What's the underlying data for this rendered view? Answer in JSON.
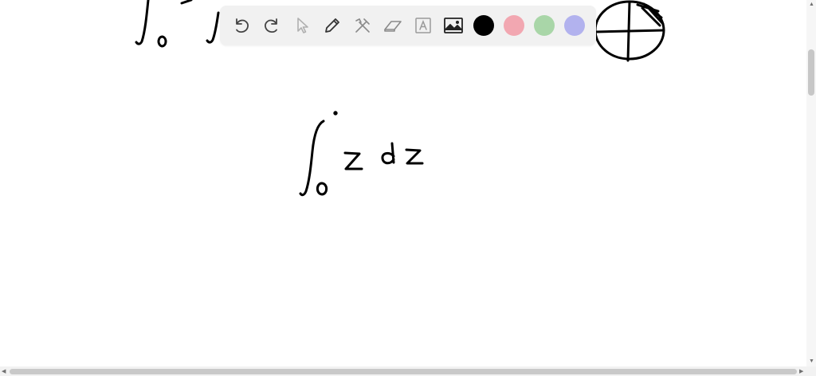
{
  "toolbar": {
    "tools": [
      {
        "name": "undo-icon",
        "label": "undo"
      },
      {
        "name": "redo-icon",
        "label": "redo"
      },
      {
        "name": "select-pointer-icon",
        "label": "select"
      },
      {
        "name": "pen-icon",
        "label": "pen"
      },
      {
        "name": "tools-icon",
        "label": "tools"
      },
      {
        "name": "eraser-icon",
        "label": "eraser"
      },
      {
        "name": "text-box-icon",
        "label": "text"
      },
      {
        "name": "image-icon",
        "label": "image"
      }
    ],
    "colors": [
      {
        "name": "color-black",
        "hex": "#000000",
        "selected": true
      },
      {
        "name": "color-pink",
        "hex": "#f2a7b1",
        "selected": false
      },
      {
        "name": "color-green",
        "hex": "#a9d6a8",
        "selected": false
      },
      {
        "name": "color-purple",
        "hex": "#b2b2ee",
        "selected": false
      }
    ]
  },
  "canvas": {
    "ink_color": "#000000",
    "handwriting": {
      "main_expression": "∫₀ z dz",
      "lower_limit": "0"
    }
  },
  "scrollbars": {
    "vertical_arrow_up": "▲",
    "vertical_arrow_down": "▼",
    "horizontal_arrow_left": "◀",
    "horizontal_arrow_right": "▶"
  }
}
